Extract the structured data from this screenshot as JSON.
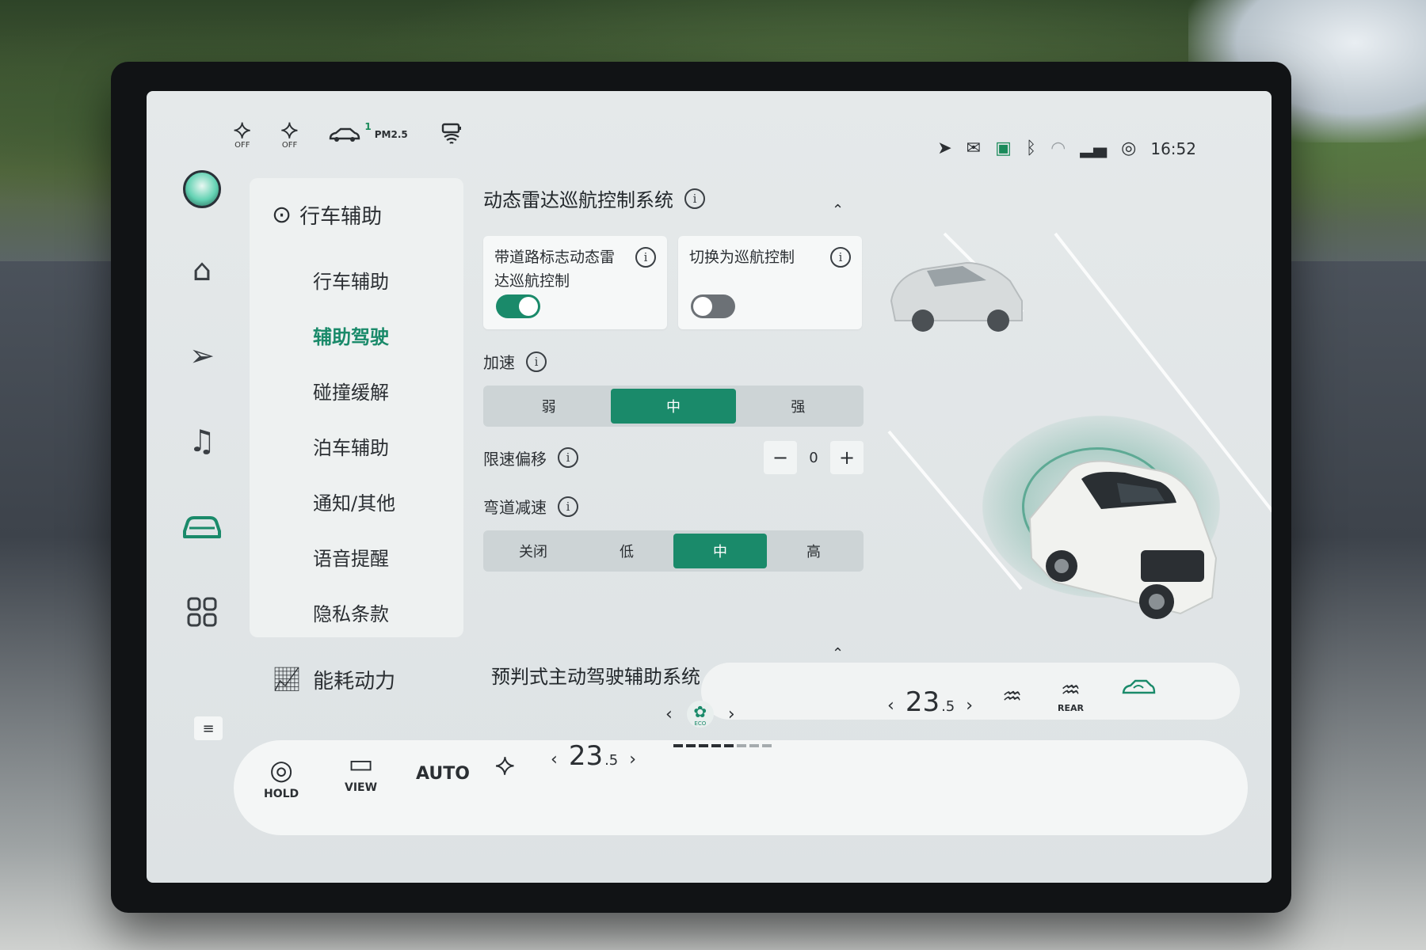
{
  "top_icons": [
    {
      "icon": "seat-heat-driver-icon",
      "sub": "OFF"
    },
    {
      "icon": "seat-heat-passenger-icon",
      "sub": "OFF"
    }
  ],
  "pm": {
    "icon": "air-quality-car-icon",
    "label": "PM2.5",
    "value": "1"
  },
  "charge": {
    "icon": "wireless-charge-icon"
  },
  "status": {
    "icons": [
      "navigation-icon",
      "message-icon",
      "camera-icon",
      "bluetooth-icon",
      "wifi-icon",
      "signal-4g-icon",
      "user-icon"
    ],
    "time": "16:52"
  },
  "rail": {
    "items": [
      "avatar",
      "home-icon",
      "navigation-icon",
      "music-icon",
      "car-icon",
      "apps-icon"
    ],
    "active": "car-icon"
  },
  "menu": {
    "header": "行车辅助",
    "items": [
      {
        "label": "行车辅助",
        "active": false
      },
      {
        "label": "辅助驾驶",
        "active": true
      },
      {
        "label": "碰撞缓解",
        "active": false
      },
      {
        "label": "泊车辅助",
        "active": false
      },
      {
        "label": "通知/其他",
        "active": false
      },
      {
        "label": "语音提醒",
        "active": false
      },
      {
        "label": "隐私条款",
        "active": false
      }
    ],
    "energy": "能耗动力"
  },
  "content": {
    "section_title": "动态雷达巡航控制系统",
    "card1": {
      "label": "带道路标志动态雷达巡航控制",
      "on": true
    },
    "card2": {
      "label": "切换为巡航控制",
      "on": false
    },
    "accel": {
      "label": "加速",
      "options": [
        "弱",
        "中",
        "强"
      ],
      "selected": "中"
    },
    "speed_offset": {
      "label": "限速偏移",
      "value": "0",
      "minus": "−",
      "plus": "+"
    },
    "curve": {
      "label": "弯道减速",
      "options": [
        "关闭",
        "低",
        "中",
        "高"
      ],
      "selected": "中"
    },
    "next_section": "预判式主动驾驶辅助系统"
  },
  "bottom": {
    "hold": "HOLD",
    "view": "VIEW",
    "auto": "AUTO",
    "temp_left": {
      "whole": "23",
      "dec": ".5"
    },
    "temp_right": {
      "whole": "23",
      "dec": ".5"
    },
    "fan_label": "ECO",
    "fan_level": 5,
    "fan_max": 8,
    "rear": "REAR"
  },
  "colors": {
    "accent": "#1a8a6a",
    "panel": "#eef1f1",
    "text": "#2b2f33"
  }
}
